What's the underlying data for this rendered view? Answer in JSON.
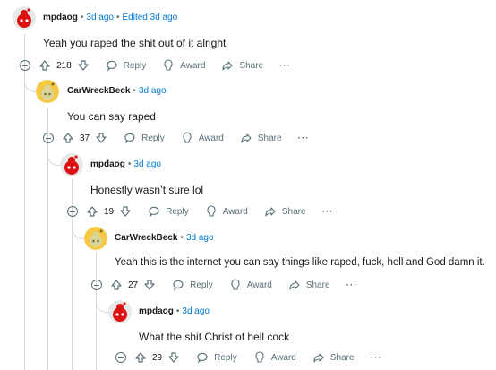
{
  "colors": {
    "accent": "#0079d3",
    "muted": "#576f76",
    "line": "#d7dadc"
  },
  "comments": [
    {
      "author": "mpdaog",
      "avatar": "red-snoo-avatar",
      "time": "3d ago",
      "edited": "Edited 3d ago",
      "body": "Yeah you raped the shit out of it alright",
      "votes": "218"
    },
    {
      "author": "CarWreckBeck",
      "avatar": "yellow-snoo-avatar",
      "time": "3d ago",
      "edited": "",
      "body": "You can say raped",
      "votes": "37"
    },
    {
      "author": "mpdaog",
      "avatar": "red-snoo-avatar",
      "time": "3d ago",
      "edited": "",
      "body": "Honestly wasn’t sure lol",
      "votes": "19"
    },
    {
      "author": "CarWreckBeck",
      "avatar": "yellow-snoo-avatar",
      "time": "3d ago",
      "edited": "",
      "body": "Yeah this is the internet you can say things like raped, fuck, hell and God damn it.",
      "votes": "27"
    },
    {
      "author": "mpdaog",
      "avatar": "red-snoo-avatar",
      "time": "3d ago",
      "edited": "",
      "body": "What the shit Christ of hell cock",
      "votes": "29"
    }
  ],
  "actions": {
    "reply": "Reply",
    "award": "Award",
    "share": "Share",
    "more": "···"
  },
  "separator": "•"
}
